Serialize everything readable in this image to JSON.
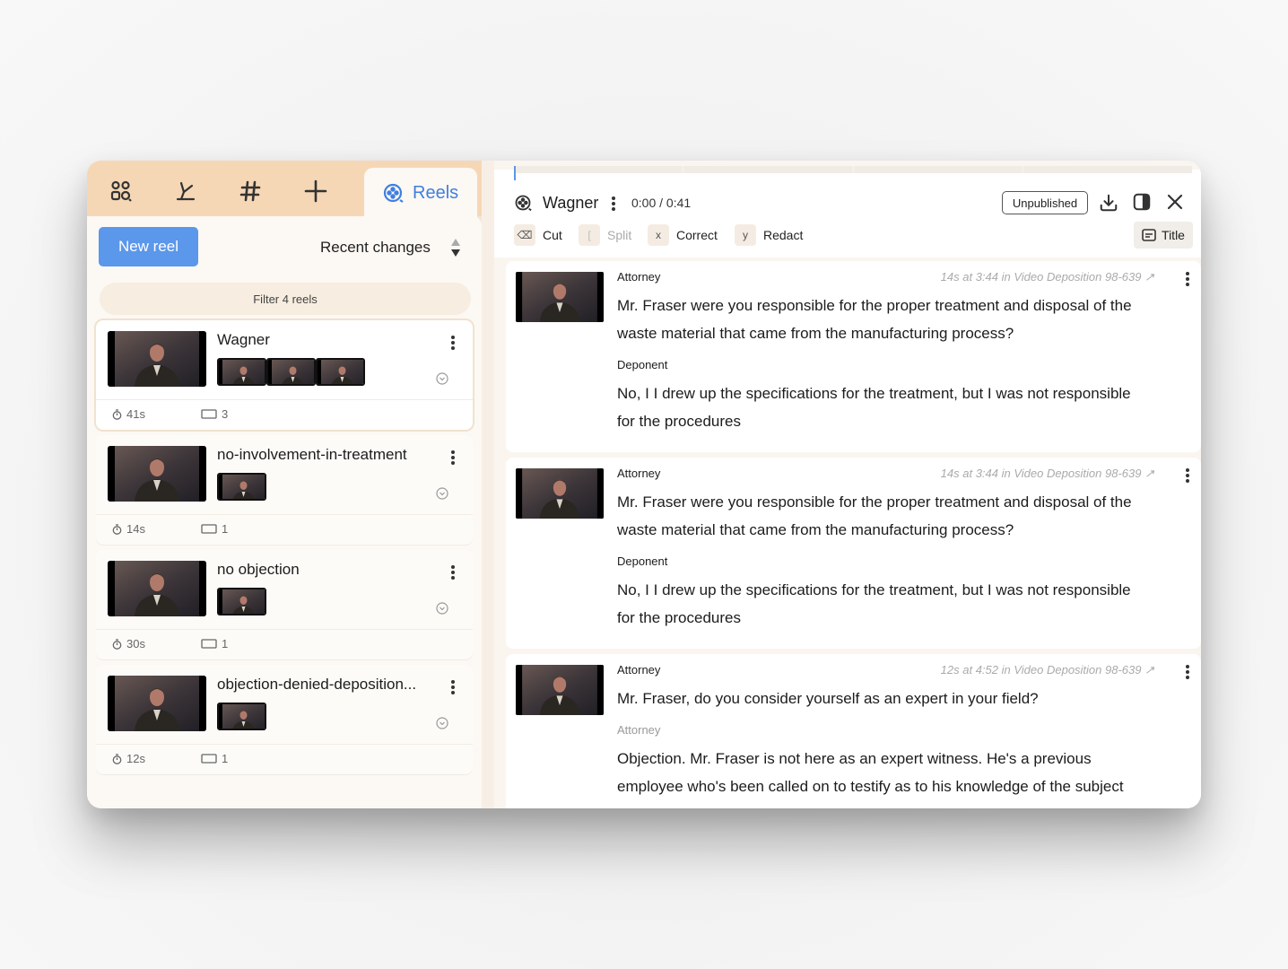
{
  "tabs": {
    "reels_label": "Reels",
    "icons": [
      "people-icon",
      "highlighter-icon",
      "hashtag-icon",
      "plus-icon",
      "reel-icon"
    ]
  },
  "sidebar": {
    "new_reel_label": "New reel",
    "sort_label": "Recent changes",
    "filter_label": "Filter 4 reels",
    "reels": [
      {
        "name": "Wagner",
        "clips": 3,
        "duration": "41s",
        "count": "3"
      },
      {
        "name": "no-involvement-in-treatment",
        "clips": 1,
        "duration": "14s",
        "count": "1"
      },
      {
        "name": "no objection",
        "clips": 1,
        "duration": "30s",
        "count": "1"
      },
      {
        "name": "objection-denied-deposition...",
        "clips": 1,
        "duration": "12s",
        "count": "1"
      }
    ]
  },
  "editor": {
    "title": "Wagner",
    "time": "0:00 / 0:41",
    "status_label": "Unpublished",
    "tools": {
      "cut": {
        "key": "⌫",
        "label": "Cut"
      },
      "split": {
        "key": "[",
        "label": "Split"
      },
      "correct": {
        "key": "x",
        "label": "Correct"
      },
      "redact": {
        "key": "y",
        "label": "Redact"
      },
      "title": "Title"
    }
  },
  "transcript": [
    {
      "source": "14s at 3:44 in Video Deposition 98-639 ↗",
      "segments": [
        {
          "speaker": "Attorney",
          "lines": [
            "Mr. Fraser were you responsible for the proper treatment and disposal of the",
            "waste material that came from the manufacturing process?"
          ]
        },
        {
          "speaker": "Deponent",
          "lines": [
            "No, I I drew up the specifications for the treatment, but I was not responsible",
            "for the procedures"
          ]
        }
      ]
    },
    {
      "source": "14s at 3:44 in Video Deposition 98-639 ↗",
      "segments": [
        {
          "speaker": "Attorney",
          "lines": [
            "Mr. Fraser were you responsible for the proper treatment and disposal of the",
            "waste material that came from the manufacturing process?"
          ]
        },
        {
          "speaker": "Deponent",
          "lines": [
            "No, I I drew up the specifications for the treatment, but I was not responsible",
            "for the procedures"
          ]
        }
      ]
    },
    {
      "source": "12s at 4:52 in Video Deposition 98-639 ↗",
      "segments": [
        {
          "speaker": "Attorney",
          "lines": [
            "Mr. Fraser, do you consider yourself as an expert in your field?"
          ]
        },
        {
          "speaker": "Attorney",
          "lines": [
            "Objection. Mr. Fraser is not here as an expert witness. He's a previous",
            "employee who's been called on to testify as to his knowledge of the subject"
          ]
        }
      ]
    }
  ],
  "colors": {
    "accent": "#3f7fe0",
    "button": "#5b97ea",
    "tab_bar": "#f6d7b5"
  }
}
